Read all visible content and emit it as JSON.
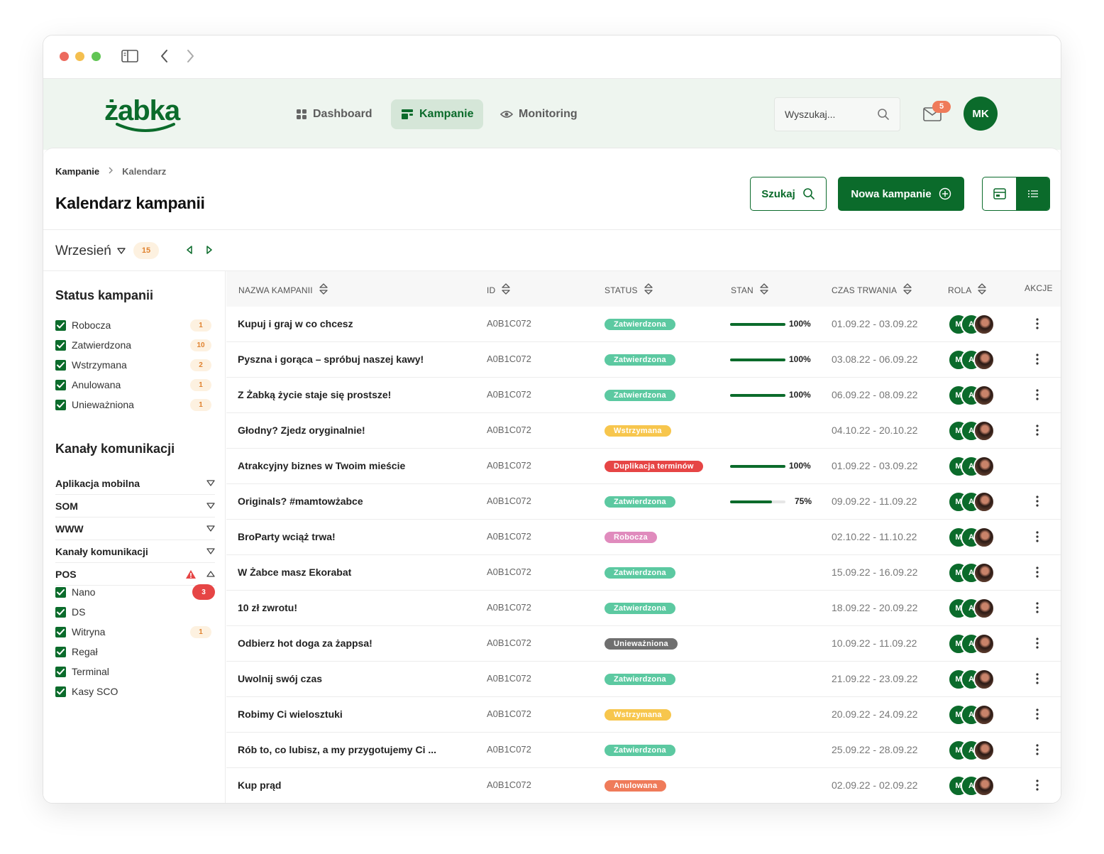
{
  "brand": {
    "logo_text": "żabka",
    "accent": "#0b6b2b"
  },
  "nav": {
    "items": [
      {
        "label": "Dashboard",
        "icon": "grid-icon",
        "active": false
      },
      {
        "label": "Kampanie",
        "icon": "campaign-icon",
        "active": true
      },
      {
        "label": "Monitoring",
        "icon": "eye-icon",
        "active": false
      }
    ],
    "search_placeholder": "Wyszukaj...",
    "mail_count": "5",
    "user_initials": "MK"
  },
  "breadcrumb": {
    "root": "Kampanie",
    "sep": ">",
    "current": "Kalendarz"
  },
  "page": {
    "title": "Kalendarz kampanii",
    "search_btn": "Szukaj",
    "new_btn": "Nowa kampanie"
  },
  "month": {
    "label": "Wrzesień",
    "count": "15"
  },
  "sidebar": {
    "status_title": "Status kampanii",
    "statuses": [
      {
        "label": "Robocza",
        "count": "1"
      },
      {
        "label": "Zatwierdzona",
        "count": "10"
      },
      {
        "label": "Wstrzymana",
        "count": "2"
      },
      {
        "label": "Anulowana",
        "count": "1"
      },
      {
        "label": "Unieważniona",
        "count": "1"
      }
    ],
    "channels_title": "Kanały komunikacji",
    "channels": [
      {
        "label": "Aplikacja mobilna"
      },
      {
        "label": "SOM"
      },
      {
        "label": "WWW"
      },
      {
        "label": "Kanały komunikacji"
      },
      {
        "label": "POS",
        "expanded": true,
        "warning": true
      }
    ],
    "pos_items": [
      {
        "label": "Nano",
        "count": "3",
        "alert": true
      },
      {
        "label": "DS",
        "count": ""
      },
      {
        "label": "Witryna",
        "count": "1"
      },
      {
        "label": "Regał",
        "count": ""
      },
      {
        "label": "Terminal",
        "count": ""
      },
      {
        "label": "Kasy SCO",
        "count": ""
      }
    ]
  },
  "table": {
    "headers": {
      "name": "NAZWA KAMPANII",
      "id": "ID",
      "status": "STATUS",
      "stan": "STAN",
      "duration": "CZAS TRWANIA",
      "role": "ROLA",
      "actions": "AKCJE"
    },
    "status_colors": {
      "Zatwierdzona": "#5cc9a1",
      "Wstrzymana": "#f7c64d",
      "Duplikacja terminów": "#e64545",
      "Robocza": "#e08bbd",
      "Unieważniona": "#6f6f6f",
      "Anulowana": "#ef7b5a"
    },
    "rows": [
      {
        "name": "Kupuj i graj w co chcesz",
        "id": "A0B1C072",
        "status": "Zatwierdzona",
        "progress": 100,
        "progress_label": "100%",
        "duration": "01.09.22 - 03.09.22",
        "actions": true
      },
      {
        "name": "Pyszna i gorąca – spróbuj naszej kawy!",
        "id": "A0B1C072",
        "status": "Zatwierdzona",
        "progress": 100,
        "progress_label": "100%",
        "duration": "03.08.22 - 06.09.22",
        "actions": true
      },
      {
        "name": "Z Żabką życie staje się prostsze!",
        "id": "A0B1C072",
        "status": "Zatwierdzona",
        "progress": 100,
        "progress_label": "100%",
        "duration": "06.09.22 - 08.09.22",
        "actions": true
      },
      {
        "name": "Głodny? Zjedz oryginalnie!",
        "id": "A0B1C072",
        "status": "Wstrzymana",
        "progress": null,
        "progress_label": "",
        "duration": "04.10.22 - 20.10.22",
        "actions": true
      },
      {
        "name": "Atrakcyjny biznes w Twoim mieście",
        "id": "A0B1C072",
        "status": "Duplikacja terminów",
        "progress": 100,
        "progress_label": "100%",
        "duration": "01.09.22 - 03.09.22",
        "actions": false
      },
      {
        "name": "Originals? #mamtowżabce",
        "id": "A0B1C072",
        "status": "Zatwierdzona",
        "progress": 75,
        "progress_label": "75%",
        "duration": "09.09.22 - 11.09.22",
        "actions": true
      },
      {
        "name": "BroParty wciąż trwa!",
        "id": "A0B1C072",
        "status": "Robocza",
        "progress": null,
        "progress_label": "",
        "duration": "02.10.22 - 11.10.22",
        "actions": true
      },
      {
        "name": "W Żabce masz Ekorabat",
        "id": "A0B1C072",
        "status": "Zatwierdzona",
        "progress": null,
        "progress_label": "",
        "duration": "15.09.22 - 16.09.22",
        "actions": true
      },
      {
        "name": "10 zł zwrotu!",
        "id": "A0B1C072",
        "status": "Zatwierdzona",
        "progress": null,
        "progress_label": "",
        "duration": "18.09.22 - 20.09.22",
        "actions": true
      },
      {
        "name": "Odbierz hot doga za żappsa!",
        "id": "A0B1C072",
        "status": "Unieważniona",
        "progress": null,
        "progress_label": "",
        "duration": "10.09.22 - 11.09.22",
        "actions": true
      },
      {
        "name": "Uwolnij swój czas",
        "id": "A0B1C072",
        "status": "Zatwierdzona",
        "progress": null,
        "progress_label": "",
        "duration": "21.09.22 - 23.09.22",
        "actions": true
      },
      {
        "name": "Robimy Ci wieloszt​uki",
        "id": "A0B1C072",
        "status": "Wstrzymana",
        "progress": null,
        "progress_label": "",
        "duration": "20.09.22 - 24.09.22",
        "actions": true
      },
      {
        "name": "Rób to, co lubisz, a my przygotujemy Ci ...",
        "id": "A0B1C072",
        "status": "Zatwierdzona",
        "progress": null,
        "progress_label": "",
        "duration": "25.09.22 - 28.09.22",
        "actions": true
      },
      {
        "name": "Kup prąd",
        "id": "A0B1C072",
        "status": "Anulowana",
        "progress": null,
        "progress_label": "",
        "duration": "02.09.22 - 02.09.22",
        "actions": true
      }
    ],
    "role_initials": [
      "M",
      "A"
    ]
  }
}
